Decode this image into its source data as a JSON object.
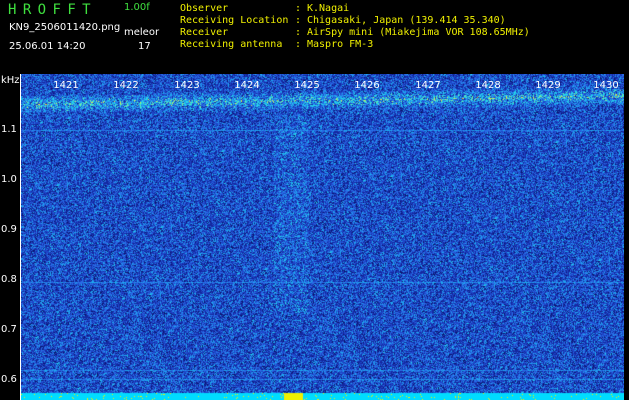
{
  "header": {
    "app_title": "HROFFT",
    "version": "1.00f",
    "filename": "KN9_2506011420.png",
    "mode": "meleor",
    "datetime": "25.06.01 14:20",
    "count": "17",
    "fields": [
      {
        "label": "Observer",
        "sep": ":",
        "value": "K.Nagai"
      },
      {
        "label": "Receiving Location",
        "sep": ":",
        "value": "Chigasaki, Japan (139.414 35.340)"
      },
      {
        "label": "Receiver",
        "sep": ":",
        "value": "AirSpy mini (Miakejima VOR 108.65MHz)"
      },
      {
        "label": "Receiving antenna",
        "sep": ":",
        "value": "Maspro FM-3"
      }
    ]
  },
  "axes": {
    "unit": "kHz",
    "freq_ticks": [
      "1421",
      "1422",
      "1423",
      "1424",
      "1425",
      "1426",
      "1427",
      "1428",
      "1429",
      "1430"
    ],
    "y_ticks": [
      "1.1",
      "1.0",
      "0.9",
      "0.8",
      "0.7",
      "0.6"
    ]
  },
  "colors": {
    "background": "#000000",
    "noise_base": "#1a2a9a",
    "title_green": "#3fe03f",
    "label_yellow": "#f0f000",
    "bottom_band": "#00e0ff"
  }
}
